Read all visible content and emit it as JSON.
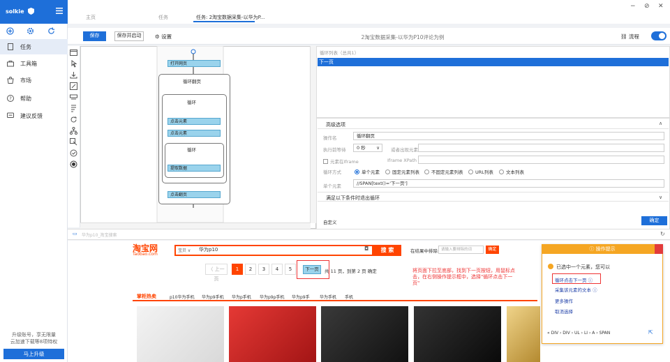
{
  "sidebar": {
    "user": "solkie",
    "items": [
      {
        "label": "任务"
      },
      {
        "label": "工具箱"
      },
      {
        "label": "市场"
      },
      {
        "label": "帮助"
      },
      {
        "label": "建议反馈"
      }
    ],
    "upgrade_text_1": "升级账号，享无限量",
    "upgrade_text_2": "云加速下载等8项特权",
    "upgrade_button": "马上升级"
  },
  "tabs": [
    {
      "label": "主页"
    },
    {
      "label": "任务"
    },
    {
      "label": "任务: 2淘宝数据采集-以华为P..."
    }
  ],
  "window_controls": {
    "minimize": "−",
    "restore": "⊘",
    "close": "✕"
  },
  "toolbar": {
    "save_label": "保存",
    "save_start_label": "保存并启动",
    "settings_label": "设置",
    "task_title": "2淘宝数据采集-以华为P10评论为例",
    "flow_label": "流程"
  },
  "flow": {
    "nodes": {
      "open": "打开网页",
      "loop_page": "循环翻页",
      "loop1": "循环",
      "click_elem1": "点击元素",
      "click_elem2": "点击元素",
      "loop2": "循环",
      "extract": "提取数据",
      "click_page": "点击翻页"
    }
  },
  "panel": {
    "list_header": "循环列表（总共1）",
    "list_row": "下一页",
    "advanced_title": "高级选项",
    "op_name_label": "操作名",
    "op_name_value": "循环翻页",
    "wait_label": "执行前等待",
    "wait_value": "0 秒",
    "or_appear_label": "或者出现元素",
    "iframe_check": "元素在Iframe",
    "iframe_xpath_label": "Iframe XPath",
    "loop_mode_label": "循环方式",
    "loop_modes": [
      "单个元素",
      "固定元素列表",
      "不固定元素列表",
      "URL列表",
      "文本列表"
    ],
    "single_elem_label": "单个元素",
    "single_elem_value": "//SPAN[text()='下一页']",
    "exit_cond": "满足以下条件时退出循环",
    "custom": "自定义",
    "ok": "确定"
  },
  "browser": {
    "address": "华为p10_淘宝搜索"
  },
  "webpage": {
    "logo": "淘宝网",
    "logo_sub": "Taobao.com",
    "search_scope": "宝贝 ∨",
    "search_query": "华为p10",
    "search_btn": "搜 索",
    "search_in_results": "在结果中排除:",
    "sir_placeholder": "请输入要排除的词",
    "sir_btn": "确定",
    "prev_page": "〈 上一页",
    "pages": [
      "1",
      "2",
      "3",
      "4",
      "5"
    ],
    "next_page": "下一页",
    "pager_info": "共 11 页，到第  2  页  确定",
    "hint": "将页面下拉至底部，找到下一页按钮，用鼠标点击，在右侧操作提示框中，选择\"循环点击下一页\"",
    "hot_label": "掌柜热卖",
    "categories": [
      "p10华为手机",
      "华为p9手机",
      "华为p手机",
      "华为p9p手机",
      "华为p9手",
      "华为手机",
      "手机"
    ]
  },
  "tip": {
    "title": "操作提示",
    "message": "已选中一个元素，您可以",
    "options": [
      "循环点击下一页",
      "采集该元素的文本",
      "更多操作",
      "取消选择"
    ],
    "path": "« DIV › DIV › UL › LI › A › SPAN"
  }
}
